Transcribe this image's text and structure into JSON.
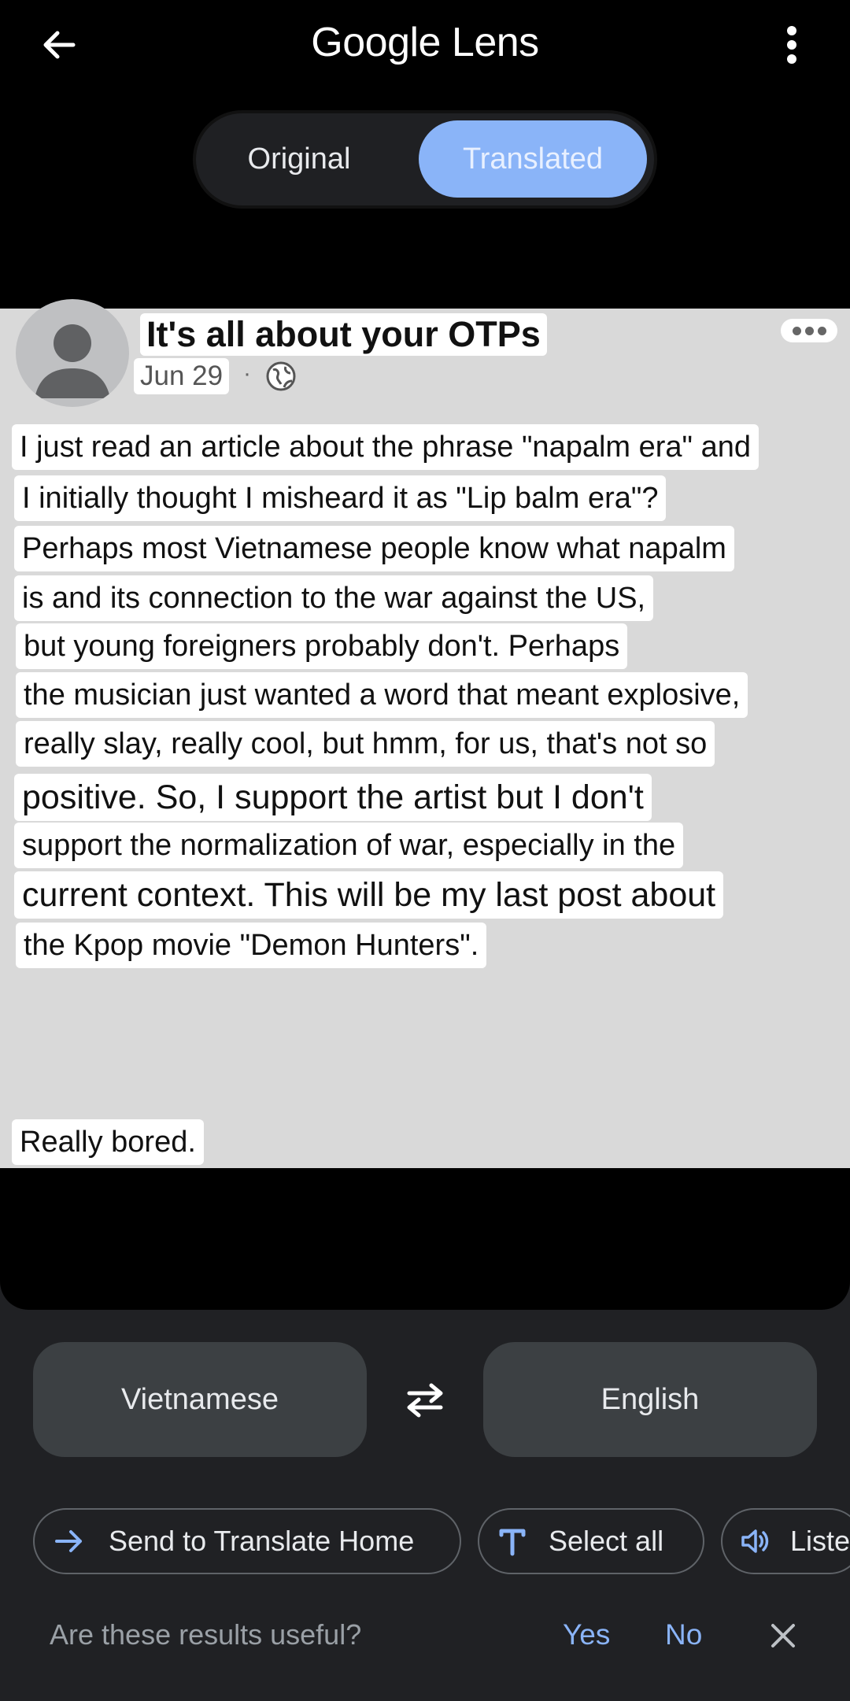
{
  "header": {
    "title": "Google Lens",
    "back_icon": "arrow-left-icon",
    "menu_icon": "more-vertical-icon"
  },
  "toggle": {
    "original_label": "Original",
    "translated_label": "Translated",
    "active": "Translated",
    "active_color": "#8ab4f8"
  },
  "post": {
    "title": "It's all about your OTPs",
    "date": "Jun 29",
    "separator": "·",
    "lines": [
      "I just read an article about the phrase \"napalm era\" and",
      "I initially thought I misheard it as \"Lip balm era\"?",
      "Perhaps most Vietnamese people know what napalm",
      "is and its connection to the war against the US,",
      "but young foreigners probably don't. Perhaps",
      "the musician just wanted a word that meant explosive,",
      "really slay, really cool, but hmm, for us, that's not so",
      "positive. So, I support the artist but I don't",
      "support the normalization of war, especially in the",
      "current context. This will be my last post about",
      "the Kpop movie \"Demon Hunters\"."
    ],
    "footer": "Really bored."
  },
  "languages": {
    "source": "Vietnamese",
    "target": "English",
    "swap_icon": "swap-arrows-icon"
  },
  "actions": {
    "send": "Send to Translate Home",
    "select_all": "Select all",
    "listen": "Listen"
  },
  "feedback": {
    "question": "Are these results useful?",
    "yes": "Yes",
    "no": "No"
  }
}
